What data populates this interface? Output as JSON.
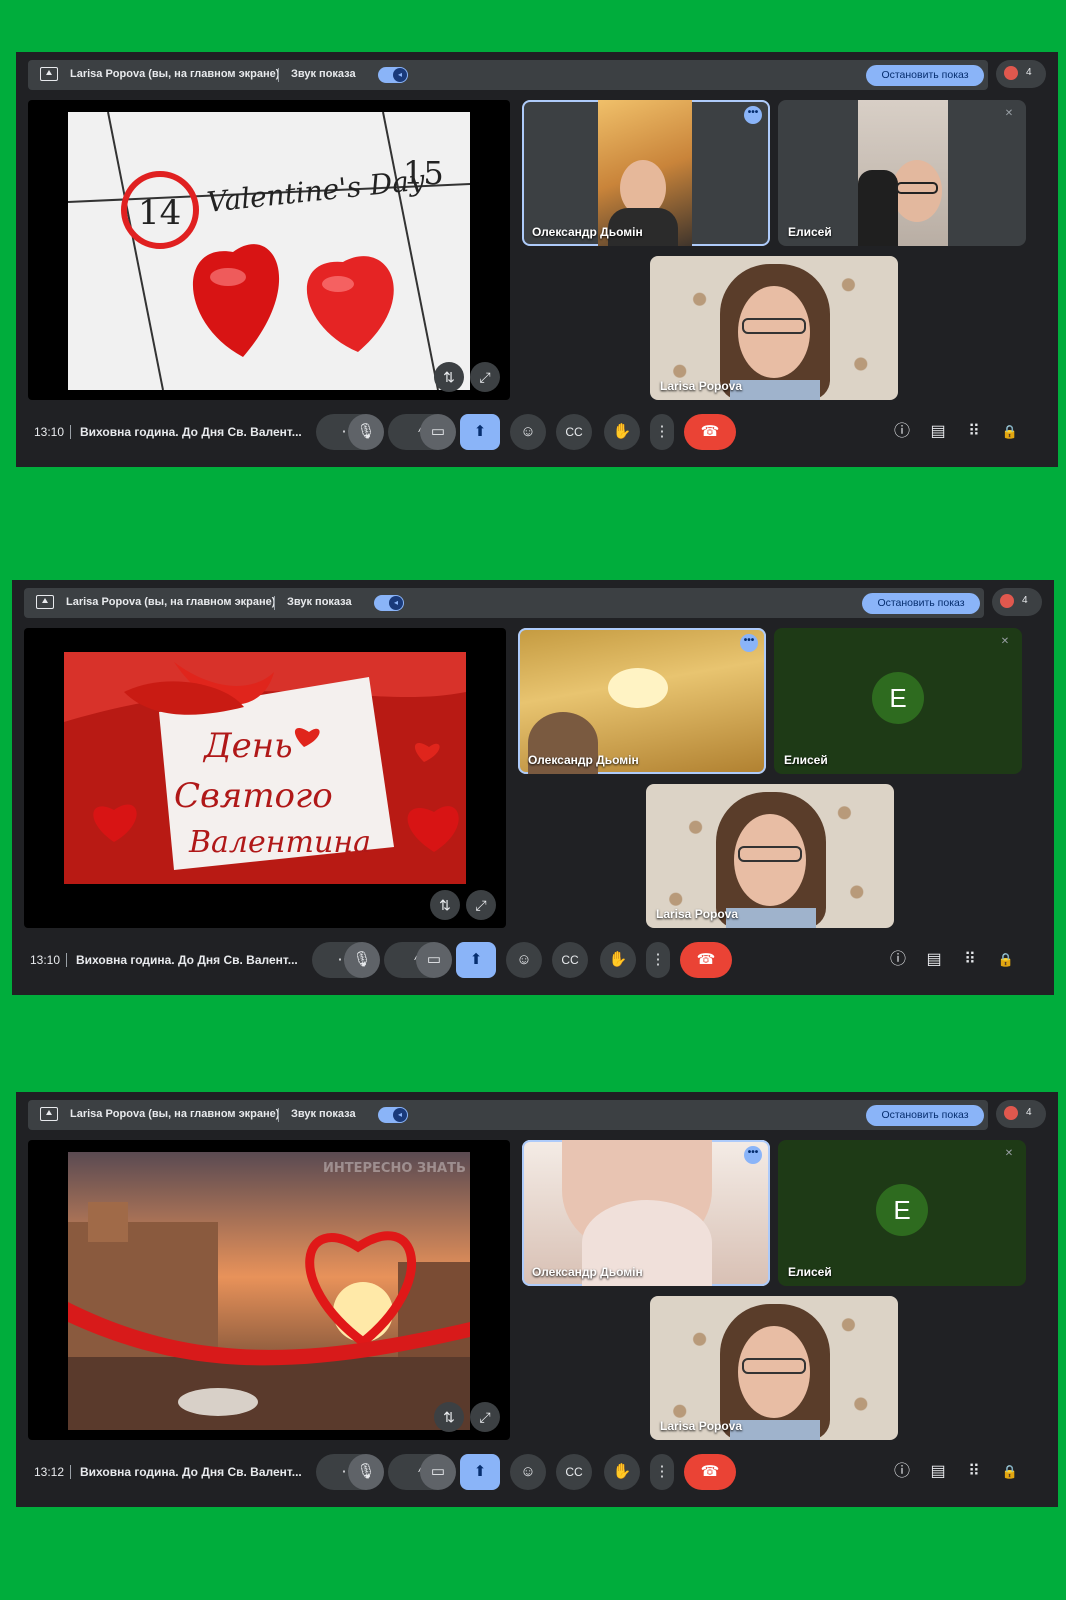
{
  "meetings": [
    {
      "presenter_label": "Larisa Popova (вы, на главном экране)",
      "audio_label": "Звук показа",
      "stop_label": "Остановить показ",
      "people_count": "4",
      "time": "13:10",
      "meeting_title": "Виховна година. До Дня Св. Валент...",
      "slide": {
        "day": "14",
        "next_day": "15",
        "caption": "Valentine's Day"
      },
      "participants": [
        "Олександр Дьомін",
        "Елисей",
        "Larisa Popova"
      ]
    },
    {
      "presenter_label": "Larisa Popova (вы, на главном экране)",
      "audio_label": "Звук показа",
      "stop_label": "Остановить показ",
      "people_count": "4",
      "time": "13:10",
      "meeting_title": "Виховна година. До Дня Св. Валент...",
      "slide": {
        "line1": "День",
        "line2": "Святого",
        "line3": "Валентина"
      },
      "participants": [
        "Олександр Дьомін",
        "Елисей",
        "Larisa Popova"
      ],
      "avatar_letter": "E"
    },
    {
      "presenter_label": "Larisa Popova (вы, на главном экране)",
      "audio_label": "Звук показа",
      "stop_label": "Остановить показ",
      "people_count": "4",
      "time": "13:12",
      "meeting_title": "Виховна година. До Дня Св. Валент...",
      "slide": {
        "watermark": "ИНТЕРЕСНО ЗНАТЬ"
      },
      "participants": [
        "Олександр Дьомін",
        "Елисей",
        "Larisa Popova"
      ],
      "avatar_letter": "E"
    }
  ],
  "icons": {
    "more": "⋯",
    "mic": "🎙",
    "chevron": "^",
    "camera": "▭",
    "present": "⬆",
    "emoji": "☺",
    "captions": "CC",
    "hand": "✋",
    "kebab": "⋮",
    "end_call": "☎",
    "info": "ⓘ",
    "chat": "▤",
    "apps": "⠿",
    "lock": "🔒",
    "swap": "⇅",
    "fullscreen": "⤢",
    "tile_menu": "•••",
    "muted": "✕"
  },
  "colors": {
    "background": "#00ad3c",
    "panel": "#202124",
    "accent": "#8ab4f8",
    "end_call": "#ea4335"
  }
}
